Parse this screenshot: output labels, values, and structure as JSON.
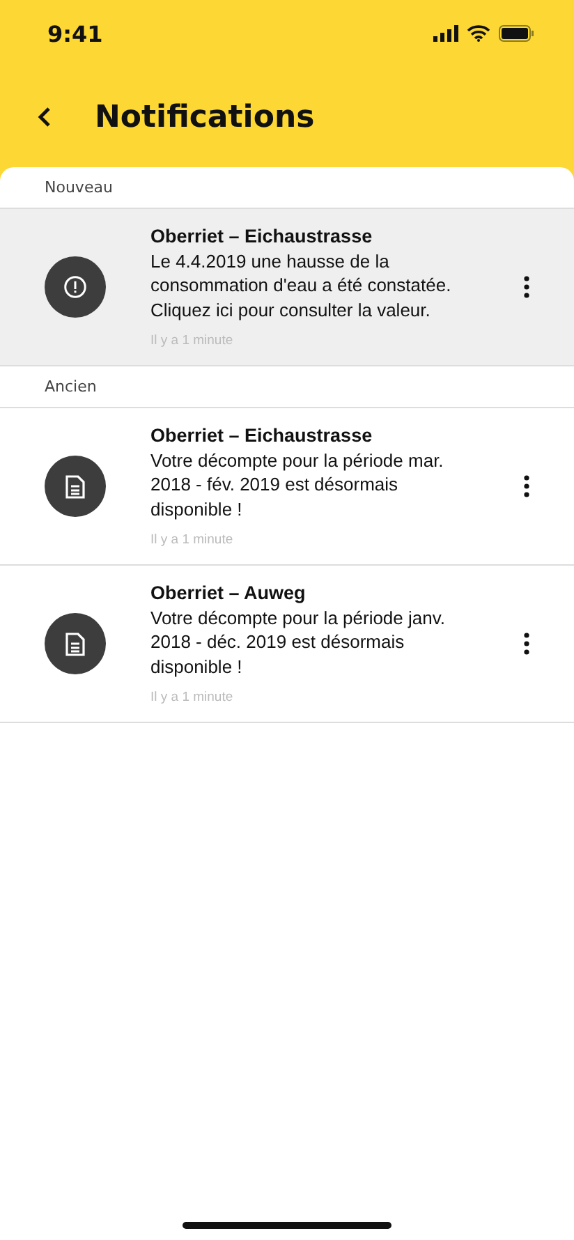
{
  "status_bar": {
    "time": "9:41"
  },
  "header": {
    "title": "Notifications"
  },
  "sections": [
    {
      "label": "Nouveau",
      "items": [
        {
          "kind": "alert",
          "unread": true,
          "title": "Oberriet – Eichaustrasse",
          "body": "Le 4.4.2019 une hausse de la consommation d'eau a été constatée. Cliquez ici pour consulter la valeur.",
          "time": "Il y a 1 minute"
        }
      ]
    },
    {
      "label": "Ancien",
      "items": [
        {
          "kind": "document",
          "unread": false,
          "title": "Oberriet – Eichaustrasse",
          "body": "Votre décompte pour la période mar. 2018 - fév. 2019 est désormais disponible !",
          "time": "Il y a 1 minute"
        },
        {
          "kind": "document",
          "unread": false,
          "title": "Oberriet – Auweg",
          "body": "Votre décompte pour la période janv. 2018 - déc. 2019 est désormais disponible !",
          "time": "Il y a 1 minute"
        }
      ]
    }
  ]
}
